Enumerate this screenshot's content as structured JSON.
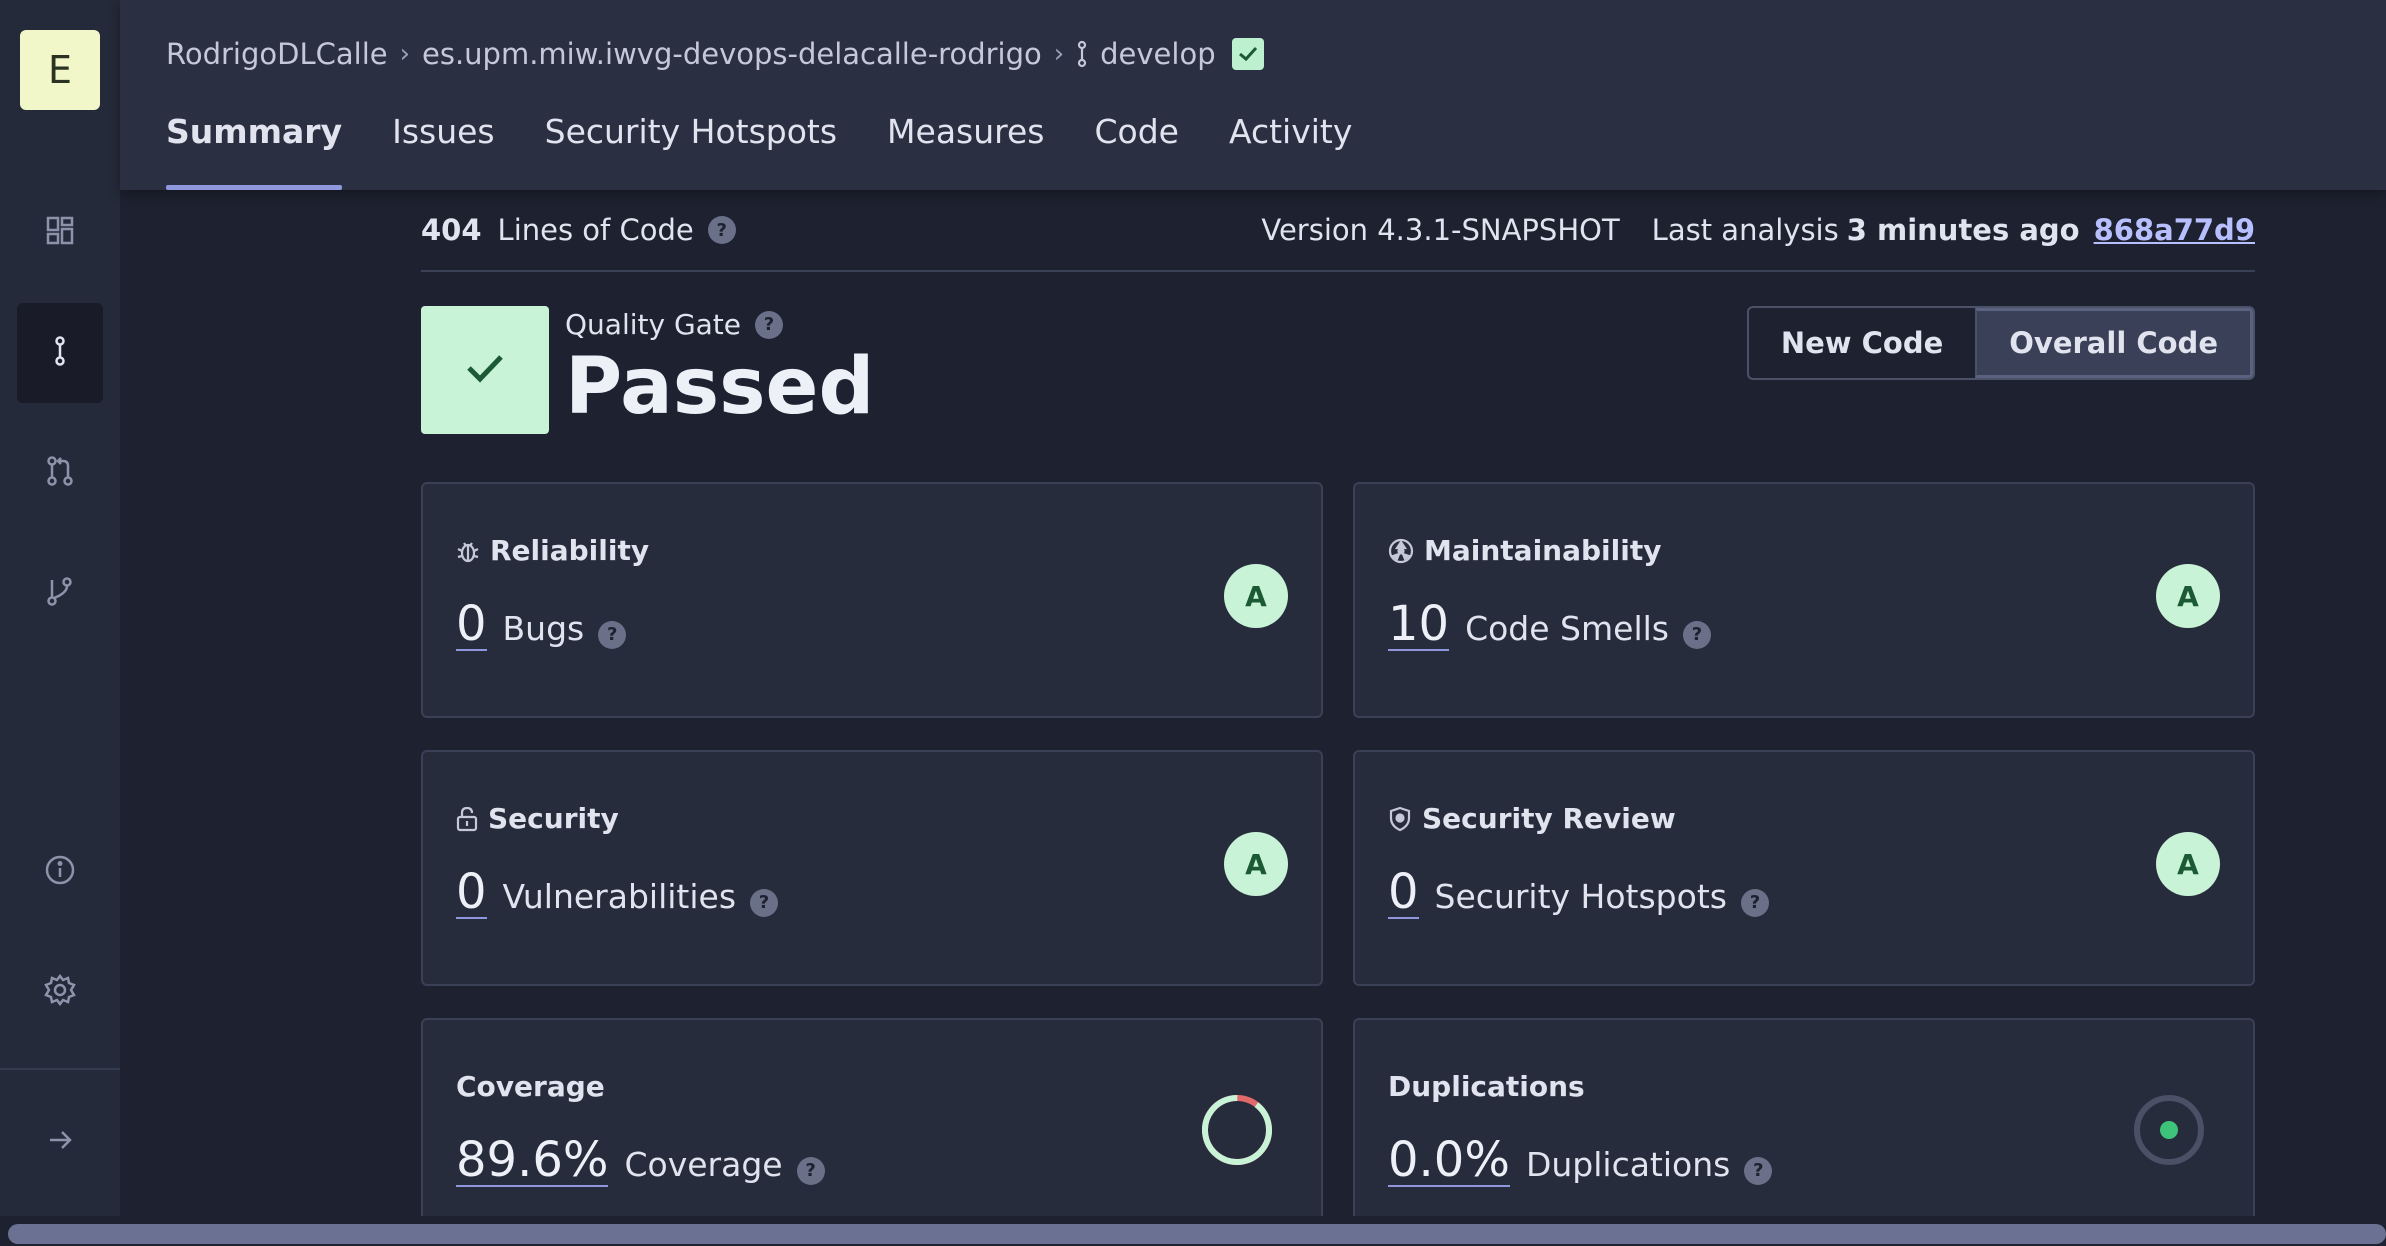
{
  "sidebar": {
    "logo_letter": "E",
    "items": [
      {
        "icon": "dashboard-icon"
      },
      {
        "icon": "branch-icon",
        "active": true
      },
      {
        "icon": "pull-request-icon"
      },
      {
        "icon": "git-branch-icon"
      },
      {
        "icon": "info-icon"
      },
      {
        "icon": "gear-icon"
      },
      {
        "icon": "expand-arrow-icon"
      }
    ]
  },
  "header": {
    "breadcrumb": {
      "org": "RodrigoDLCalle",
      "project": "es.upm.miw.iwvg-devops-delacalle-rodrigo",
      "branch": "develop"
    },
    "tabs": [
      "Summary",
      "Issues",
      "Security Hotspots",
      "Measures",
      "Code",
      "Activity"
    ],
    "active_tab": "Summary"
  },
  "meta": {
    "lines_of_code": "404",
    "lines_label": "Lines of Code",
    "version": "Version 4.3.1-SNAPSHOT",
    "last_analysis_label": "Last analysis",
    "last_analysis_value": "3 minutes ago",
    "commit": "868a77d9"
  },
  "quality_gate": {
    "label": "Quality Gate",
    "status": "Passed"
  },
  "toggle": {
    "new_code": "New Code",
    "overall_code": "Overall Code",
    "selected": "Overall Code"
  },
  "cards": {
    "reliability": {
      "title": "Reliability",
      "value": "0",
      "unit": "Bugs",
      "grade": "A"
    },
    "maintainability": {
      "title": "Maintainability",
      "value": "10",
      "unit": "Code Smells",
      "grade": "A"
    },
    "security": {
      "title": "Security",
      "value": "0",
      "unit": "Vulnerabilities",
      "grade": "A"
    },
    "security_review": {
      "title": "Security Review",
      "value": "0",
      "unit": "Security Hotspots",
      "grade": "A"
    },
    "coverage": {
      "title": "Coverage",
      "value": "89.6%",
      "unit": "Coverage",
      "percent": 89.6
    },
    "duplications": {
      "title": "Duplications",
      "value": "0.0%",
      "unit": "Duplications",
      "percent": 0.0
    }
  },
  "colors": {
    "accent": "#8f98dd",
    "passed": "#c9f3d6",
    "coverage_good": "#c9f3d6",
    "coverage_bad": "#e36a6a",
    "dup_dot": "#3ec47a"
  }
}
